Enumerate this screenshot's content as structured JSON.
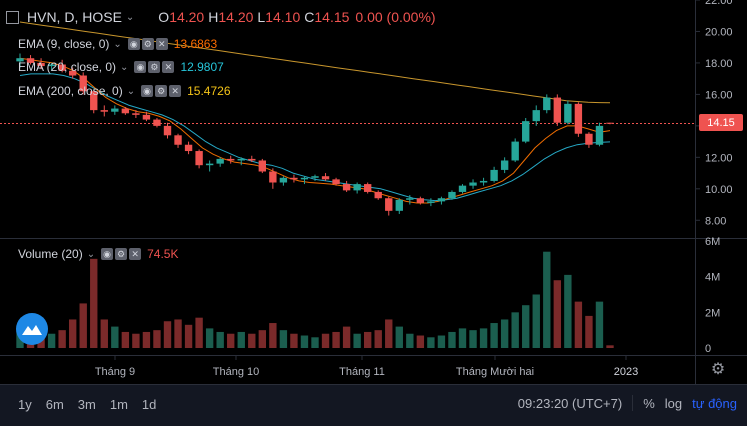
{
  "header": {
    "symbol": "HVN, D, HOSE",
    "open_label": "O",
    "open": "14.20",
    "high_label": "H",
    "high": "14.20",
    "low_label": "L",
    "low": "14.10",
    "close_label": "C",
    "close": "14.15",
    "change": "0.00 (0.00%)"
  },
  "indicators": [
    {
      "label": "EMA (9, close, 0)",
      "value": "13.6863",
      "color": "#ff6d00"
    },
    {
      "label": "EMA (20, close, 0)",
      "value": "12.9807",
      "color": "#26c6da"
    },
    {
      "label": "EMA (200, close, 0)",
      "value": "15.4726",
      "color": "#f5c518"
    }
  ],
  "volume_indicator": {
    "label": "Volume (20)",
    "value": "74.5K"
  },
  "price_badge": "14.15",
  "bottom": {
    "ranges": [
      "1y",
      "6m",
      "3m",
      "1m",
      "1d"
    ],
    "time": "09:23:20 (UTC+7)",
    "percent": "%",
    "log": "log",
    "auto": "tự động"
  },
  "chart_data": {
    "type": "candlestick",
    "price_axis": {
      "min": 7,
      "max": 22,
      "ticks": [
        8.0,
        10.0,
        12.0,
        14.0,
        16.0,
        18.0,
        20.0,
        22.0
      ]
    },
    "volume_axis": {
      "min": 0,
      "max": 6,
      "unit": "M",
      "ticks": [
        "0",
        "2M",
        "4M",
        "6M"
      ]
    },
    "x_labels": [
      "Tháng 9",
      "Tháng 10",
      "Tháng 11",
      "Tháng Mười hai",
      "2023"
    ],
    "colors": {
      "up": "#26a69a",
      "down": "#ef5350",
      "vol_up": "#1b5e4f",
      "vol_down": "#7b2a2a"
    },
    "ema200": [
      20.6,
      20.5,
      20.4,
      20.3,
      20.2,
      20.1,
      20.0,
      19.9,
      19.8,
      19.7,
      19.6,
      19.5,
      19.4,
      19.3,
      19.2,
      19.1,
      19.0,
      18.9,
      18.8,
      18.7,
      18.6,
      18.5,
      18.4,
      18.3,
      18.2,
      18.1,
      18.0,
      17.9,
      17.8,
      17.7,
      17.6,
      17.5,
      17.4,
      17.3,
      17.2,
      17.1,
      17.0,
      16.9,
      16.8,
      16.7,
      16.6,
      16.5,
      16.4,
      16.3,
      16.2,
      16.1,
      16.0,
      15.9,
      15.8,
      15.7,
      15.6,
      15.55,
      15.5,
      15.48,
      15.47
    ],
    "ema9": [
      18.3,
      18.2,
      18.1,
      18.0,
      17.8,
      17.5,
      17.0,
      16.4,
      15.8,
      15.4,
      15.1,
      14.9,
      14.8,
      14.6,
      14.3,
      13.8,
      13.2,
      12.6,
      12.2,
      11.9,
      11.7,
      11.6,
      11.5,
      11.3,
      11.0,
      10.7,
      10.5,
      10.4,
      10.35,
      10.3,
      10.2,
      10.1,
      10.0,
      9.8,
      9.6,
      9.4,
      9.2,
      9.1,
      9.1,
      9.2,
      9.4,
      9.6,
      9.8,
      10.0,
      10.2,
      10.5,
      11.0,
      11.8,
      12.6,
      13.2,
      13.7,
      14.0,
      14.0,
      13.8,
      13.6,
      13.7
    ],
    "ema20": [
      17.2,
      17.3,
      17.3,
      17.3,
      17.2,
      17.0,
      16.7,
      16.3,
      15.9,
      15.6,
      15.3,
      15.1,
      14.9,
      14.7,
      14.4,
      14.0,
      13.5,
      13.0,
      12.6,
      12.3,
      12.0,
      11.8,
      11.6,
      11.5,
      11.3,
      11.0,
      10.8,
      10.6,
      10.5,
      10.4,
      10.3,
      10.2,
      10.1,
      10.0,
      9.8,
      9.6,
      9.4,
      9.3,
      9.25,
      9.3,
      9.4,
      9.6,
      9.8,
      10.0,
      10.2,
      10.5,
      10.9,
      11.4,
      11.9,
      12.3,
      12.6,
      12.8,
      12.9,
      12.95,
      12.98
    ],
    "candles": [
      {
        "o": 18.1,
        "h": 18.6,
        "l": 17.7,
        "c": 18.3
      },
      {
        "o": 18.3,
        "h": 18.5,
        "l": 17.9,
        "c": 18.0
      },
      {
        "o": 18.0,
        "h": 18.3,
        "l": 17.6,
        "c": 17.8
      },
      {
        "o": 17.8,
        "h": 18.0,
        "l": 17.5,
        "c": 17.9
      },
      {
        "o": 17.9,
        "h": 18.2,
        "l": 17.4,
        "c": 17.5
      },
      {
        "o": 17.5,
        "h": 17.7,
        "l": 17.0,
        "c": 17.2
      },
      {
        "o": 17.2,
        "h": 17.4,
        "l": 16.0,
        "c": 16.2
      },
      {
        "o": 16.2,
        "h": 16.3,
        "l": 14.8,
        "c": 15.0
      },
      {
        "o": 15.0,
        "h": 15.3,
        "l": 14.6,
        "c": 14.9
      },
      {
        "o": 14.9,
        "h": 15.3,
        "l": 14.7,
        "c": 15.1
      },
      {
        "o": 15.1,
        "h": 15.2,
        "l": 14.7,
        "c": 14.8
      },
      {
        "o": 14.8,
        "h": 15.0,
        "l": 14.5,
        "c": 14.7
      },
      {
        "o": 14.7,
        "h": 14.9,
        "l": 14.3,
        "c": 14.4
      },
      {
        "o": 14.4,
        "h": 14.5,
        "l": 13.9,
        "c": 14.0
      },
      {
        "o": 14.0,
        "h": 14.2,
        "l": 13.2,
        "c": 13.4
      },
      {
        "o": 13.4,
        "h": 13.5,
        "l": 12.6,
        "c": 12.8
      },
      {
        "o": 12.8,
        "h": 13.0,
        "l": 12.2,
        "c": 12.4
      },
      {
        "o": 12.4,
        "h": 12.5,
        "l": 11.3,
        "c": 11.5
      },
      {
        "o": 11.5,
        "h": 11.8,
        "l": 11.1,
        "c": 11.6
      },
      {
        "o": 11.6,
        "h": 12.0,
        "l": 11.4,
        "c": 11.9
      },
      {
        "o": 11.9,
        "h": 12.1,
        "l": 11.6,
        "c": 11.8
      },
      {
        "o": 11.8,
        "h": 12.0,
        "l": 11.5,
        "c": 11.9
      },
      {
        "o": 11.9,
        "h": 12.1,
        "l": 11.7,
        "c": 11.8
      },
      {
        "o": 11.8,
        "h": 11.9,
        "l": 11.0,
        "c": 11.1
      },
      {
        "o": 11.1,
        "h": 11.3,
        "l": 10.0,
        "c": 10.4
      },
      {
        "o": 10.4,
        "h": 10.8,
        "l": 10.2,
        "c": 10.7
      },
      {
        "o": 10.7,
        "h": 10.9,
        "l": 10.4,
        "c": 10.6
      },
      {
        "o": 10.6,
        "h": 10.8,
        "l": 10.3,
        "c": 10.7
      },
      {
        "o": 10.7,
        "h": 10.9,
        "l": 10.5,
        "c": 10.8
      },
      {
        "o": 10.8,
        "h": 11.0,
        "l": 10.5,
        "c": 10.6
      },
      {
        "o": 10.6,
        "h": 10.7,
        "l": 10.2,
        "c": 10.3
      },
      {
        "o": 10.3,
        "h": 10.5,
        "l": 9.8,
        "c": 9.9
      },
      {
        "o": 9.9,
        "h": 10.4,
        "l": 9.7,
        "c": 10.3
      },
      {
        "o": 10.3,
        "h": 10.4,
        "l": 9.7,
        "c": 9.8
      },
      {
        "o": 9.8,
        "h": 9.9,
        "l": 9.3,
        "c": 9.4
      },
      {
        "o": 9.4,
        "h": 9.5,
        "l": 8.3,
        "c": 8.6
      },
      {
        "o": 8.6,
        "h": 9.4,
        "l": 8.4,
        "c": 9.3
      },
      {
        "o": 9.3,
        "h": 9.6,
        "l": 9.0,
        "c": 9.4
      },
      {
        "o": 9.4,
        "h": 9.5,
        "l": 9.0,
        "c": 9.1
      },
      {
        "o": 9.1,
        "h": 9.4,
        "l": 8.9,
        "c": 9.2
      },
      {
        "o": 9.2,
        "h": 9.5,
        "l": 9.0,
        "c": 9.4
      },
      {
        "o": 9.4,
        "h": 9.9,
        "l": 9.3,
        "c": 9.8
      },
      {
        "o": 9.8,
        "h": 10.3,
        "l": 9.7,
        "c": 10.2
      },
      {
        "o": 10.2,
        "h": 10.6,
        "l": 10.0,
        "c": 10.4
      },
      {
        "o": 10.4,
        "h": 10.7,
        "l": 10.2,
        "c": 10.5
      },
      {
        "o": 10.5,
        "h": 11.4,
        "l": 10.4,
        "c": 11.2
      },
      {
        "o": 11.2,
        "h": 12.0,
        "l": 11.0,
        "c": 11.8
      },
      {
        "o": 11.8,
        "h": 13.2,
        "l": 11.7,
        "c": 13.0
      },
      {
        "o": 13.0,
        "h": 14.5,
        "l": 12.9,
        "c": 14.3
      },
      {
        "o": 14.3,
        "h": 15.3,
        "l": 14.0,
        "c": 15.0
      },
      {
        "o": 15.0,
        "h": 16.0,
        "l": 14.8,
        "c": 15.8
      },
      {
        "o": 15.8,
        "h": 16.0,
        "l": 14.0,
        "c": 14.2
      },
      {
        "o": 14.2,
        "h": 15.6,
        "l": 14.1,
        "c": 15.4
      },
      {
        "o": 15.4,
        "h": 15.5,
        "l": 13.3,
        "c": 13.5
      },
      {
        "o": 13.5,
        "h": 13.6,
        "l": 12.6,
        "c": 12.8
      },
      {
        "o": 12.8,
        "h": 14.2,
        "l": 12.7,
        "c": 14.0
      },
      {
        "o": 14.2,
        "h": 14.2,
        "l": 14.1,
        "c": 14.15
      }
    ],
    "volumes": [
      1.1,
      1.3,
      0.9,
      0.8,
      1.0,
      1.6,
      2.5,
      5.0,
      1.6,
      1.2,
      0.9,
      0.8,
      0.9,
      1.0,
      1.5,
      1.6,
      1.3,
      1.7,
      1.1,
      0.9,
      0.8,
      0.9,
      0.8,
      1.0,
      1.4,
      1.0,
      0.8,
      0.7,
      0.6,
      0.8,
      0.9,
      1.2,
      0.8,
      0.9,
      1.0,
      1.6,
      1.2,
      0.8,
      0.7,
      0.6,
      0.7,
      0.9,
      1.1,
      1.0,
      1.1,
      1.4,
      1.6,
      2.0,
      2.4,
      3.0,
      5.4,
      3.8,
      4.1,
      2.6,
      1.8,
      2.6,
      0.15
    ],
    "price_line": 14.15
  }
}
